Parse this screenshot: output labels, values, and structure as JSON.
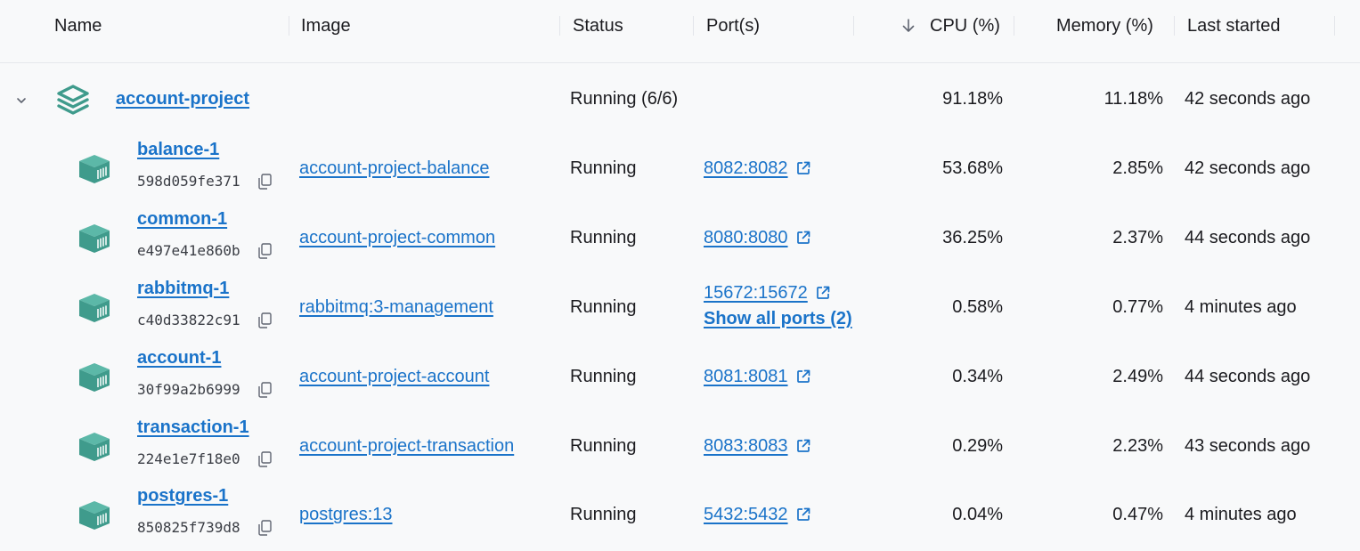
{
  "header": {
    "name": "Name",
    "image": "Image",
    "status": "Status",
    "ports": "Port(s)",
    "cpu": "CPU (%)",
    "memory": "Memory (%)",
    "last_started": "Last started",
    "sort_icon": "arrow-down-icon"
  },
  "colors": {
    "link": "#1a73c9",
    "container_icon": "#3f9b8c",
    "background": "#f8f9fa"
  },
  "project": {
    "name": "account-project",
    "status": "Running (6/6)",
    "cpu": "91.18%",
    "memory": "11.18%",
    "last_started": "42 seconds ago",
    "expand_icon": "chevron-down-icon",
    "icon": "stack-layers-icon"
  },
  "containers": [
    {
      "name": "balance-1",
      "id": "598d059fe371",
      "image": "account-project-balance",
      "status": "Running",
      "port": "8082:8082",
      "cpu": "53.68%",
      "memory": "2.85%",
      "last_started": "42 seconds ago"
    },
    {
      "name": "common-1",
      "id": "e497e41e860b",
      "image": "account-project-common",
      "status": "Running",
      "port": "8080:8080",
      "cpu": "36.25%",
      "memory": "2.37%",
      "last_started": "44 seconds ago"
    },
    {
      "name": "rabbitmq-1",
      "id": "c40d33822c91",
      "image": "rabbitmq:3-management",
      "status": "Running",
      "port": "15672:15672",
      "show_all": "Show all ports (2)",
      "cpu": "0.58%",
      "memory": "0.77%",
      "last_started": "4 minutes ago"
    },
    {
      "name": "account-1",
      "id": "30f99a2b6999",
      "image": "account-project-account",
      "status": "Running",
      "port": "8081:8081",
      "cpu": "0.34%",
      "memory": "2.49%",
      "last_started": "44 seconds ago"
    },
    {
      "name": "transaction-1",
      "id": "224e1e7f18e0",
      "image": "account-project-transaction",
      "status": "Running",
      "port": "8083:8083",
      "cpu": "0.29%",
      "memory": "2.23%",
      "last_started": "43 seconds ago"
    },
    {
      "name": "postgres-1",
      "id": "850825f739d8",
      "image": "postgres:13",
      "status": "Running",
      "port": "5432:5432",
      "cpu": "0.04%",
      "memory": "0.47%",
      "last_started": "4 minutes ago"
    }
  ]
}
